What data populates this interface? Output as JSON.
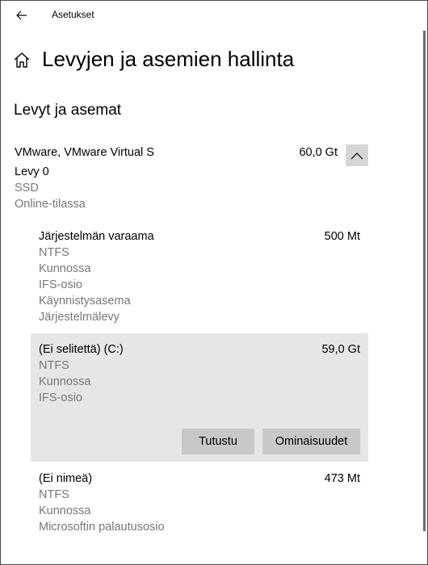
{
  "window": {
    "app_title": "Asetukset"
  },
  "page": {
    "title": "Levyjen ja asemien hallinta"
  },
  "section": {
    "title": "Levyt ja asemat"
  },
  "disk": {
    "name": "VMware, VMware Virtual S",
    "size": "60,0 Gt",
    "number": "Levy 0",
    "type": "SSD",
    "status": "Online-tilassa"
  },
  "volumes": [
    {
      "name": "Järjestelmän varaama",
      "size": "500 Mt",
      "details": [
        "NTFS",
        "Kunnossa",
        "IFS-osio",
        "Käynnistysasema",
        "Järjestelmälevy"
      ]
    },
    {
      "name": "(Ei selitettä) (C:)",
      "size": "59,0 Gt",
      "details": [
        "NTFS",
        "Kunnossa",
        "IFS-osio"
      ]
    },
    {
      "name": "(Ei nimeä)",
      "size": "473 Mt",
      "details": [
        "NTFS",
        "Kunnossa",
        "Microsoftin palautusosio"
      ]
    }
  ],
  "actions": {
    "explore_label": "Tutustu",
    "properties_label": "Ominaisuudet"
  },
  "icons": {
    "back": "back-arrow-icon",
    "home": "home-icon",
    "collapse": "chevron-up-icon"
  }
}
